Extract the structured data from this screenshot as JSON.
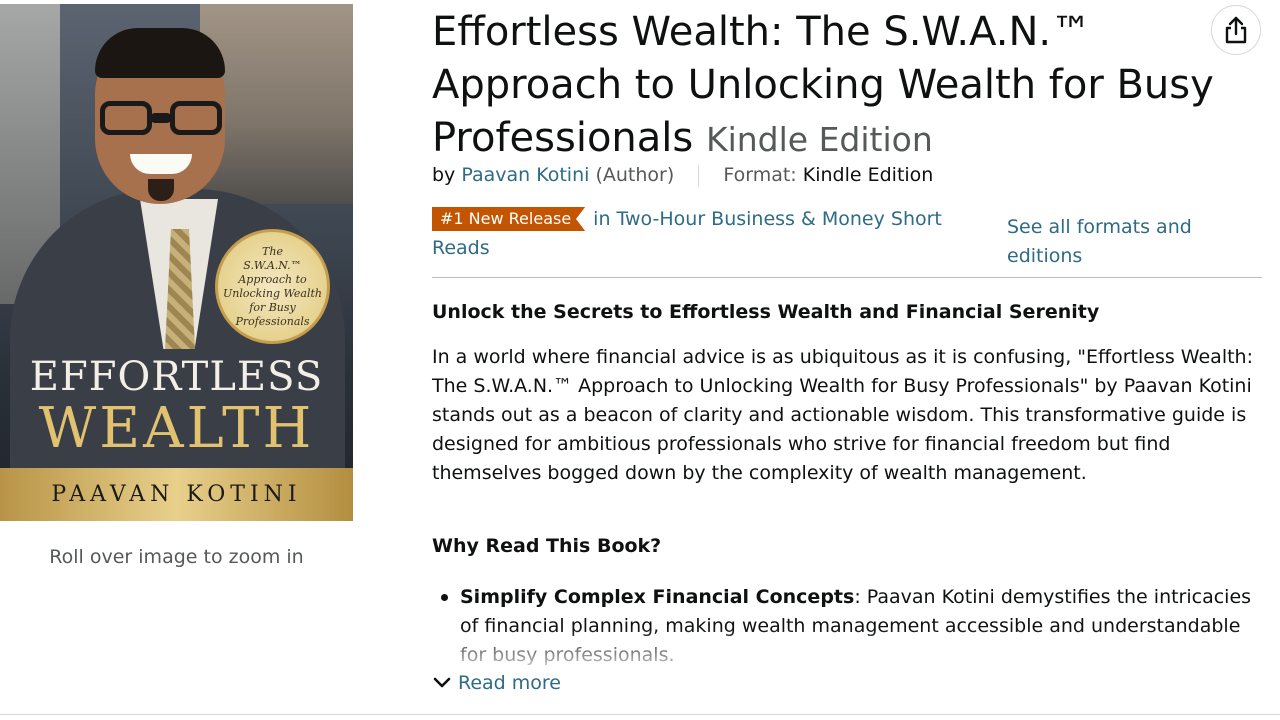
{
  "cover": {
    "seal_lines": [
      "The",
      "S.W.A.N.™",
      "Approach to",
      "Unlocking Wealth",
      "for Busy",
      "Professionals"
    ],
    "title_line1": "EFFORTLESS",
    "title_line2": "WEALTH",
    "author": "PAAVAN KOTINI"
  },
  "zoom_hint": "Roll over image to zoom in",
  "product": {
    "title": "Effortless Wealth: The S.W.A.N.™ Approach to Unlocking Wealth for Busy Professionals",
    "edition": "Kindle Edition",
    "by_label": "by",
    "author": "Paavan Kotini",
    "author_role": "(Author)",
    "format_label": "Format:",
    "format_value": "Kindle Edition",
    "badge": "#1 New Release",
    "category": "in Two-Hour Business & Money Short Reads",
    "see_all_formats": "See all formats and editions"
  },
  "description": {
    "heading": "Unlock the Secrets to Effortless Wealth and Financial Serenity",
    "paragraph": "In a world where financial advice is as ubiquitous as it is confusing, \"Effortless Wealth: The S.W.A.N.™ Approach to Unlocking Wealth for Busy Professionals\" by Paavan Kotini stands out as a beacon of clarity and actionable wisdom. This transformative guide is designed for ambitious professionals who strive for financial freedom but find themselves bogged down by the complexity of wealth management.",
    "why_heading": "Why Read This Book?",
    "bullets": [
      {
        "bold": "Simplify Complex Financial Concepts",
        "text": ": Paavan Kotini demystifies the intricacies of financial planning, making wealth management accessible and understandable for busy professionals."
      }
    ],
    "read_more": "Read more"
  },
  "icons": {
    "share": "share-icon",
    "chevron": "chevron-down-icon"
  },
  "colors": {
    "link": "#2e6b85",
    "badge": "#c45500",
    "text": "#0f1111",
    "muted": "#565959"
  }
}
